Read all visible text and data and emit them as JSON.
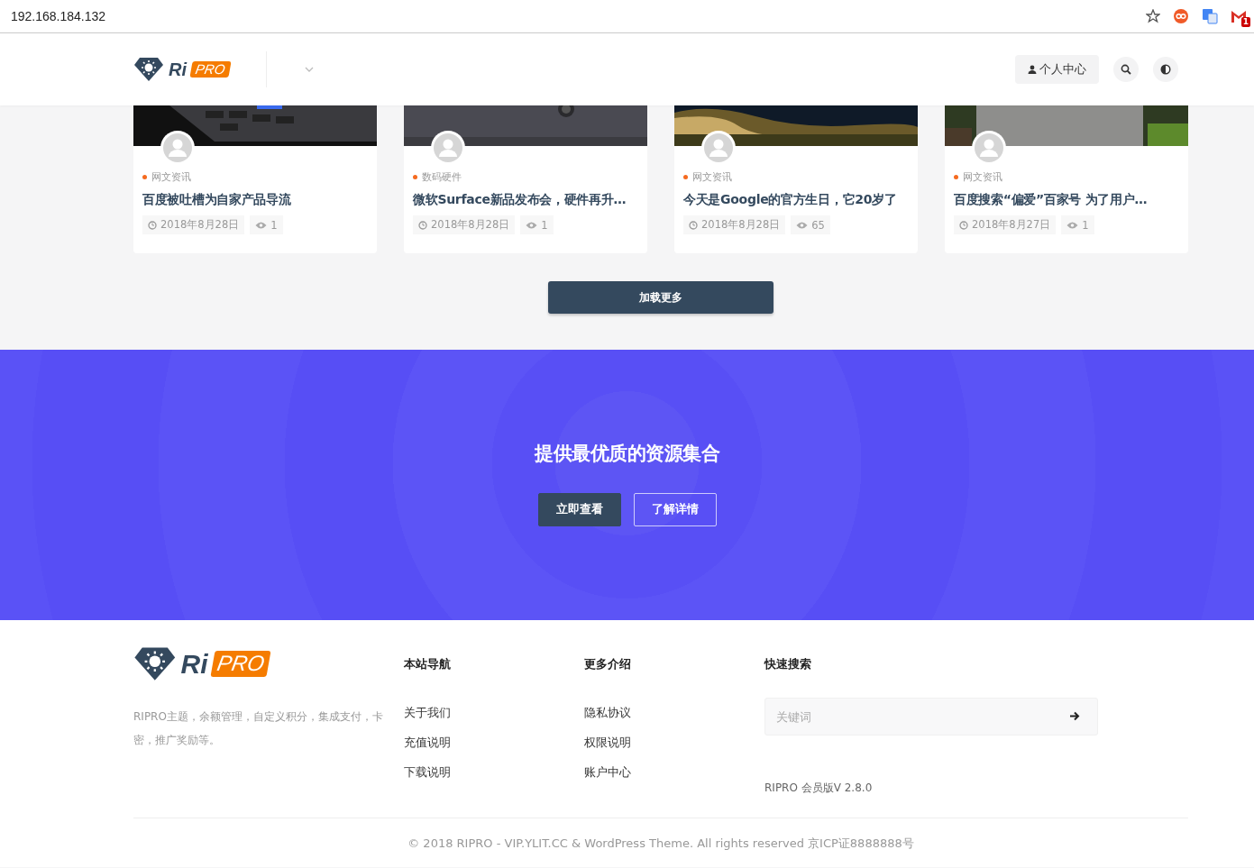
{
  "browser": {
    "url": "192.168.184.132",
    "mail_badge": "1"
  },
  "header": {
    "logo": {
      "left": "Ri",
      "right": "PRO"
    },
    "user_button": "个人中心"
  },
  "posts": [
    {
      "category": "网文资讯",
      "title": "百度被吐槽为自家产品导流",
      "date": "2018年8月28日",
      "views": "1"
    },
    {
      "category": "数码硬件",
      "title": "微软Surface新品发布会，硬件再升…",
      "date": "2018年8月28日",
      "views": "1"
    },
    {
      "category": "网文资讯",
      "title": "今天是Google的官方生日，它20岁了",
      "date": "2018年8月28日",
      "views": "65"
    },
    {
      "category": "网文资讯",
      "title": "百度搜索“偏爱”百家号 为了用户…",
      "date": "2018年8月27日",
      "views": "1"
    }
  ],
  "load_more": "加载更多",
  "banner": {
    "title": "提供最优质的资源集合",
    "buttons": [
      {
        "label": "立即查看",
        "kind": "solid"
      },
      {
        "label": "了解详情",
        "kind": "outline"
      }
    ]
  },
  "footer": {
    "logo": {
      "left": "Ri",
      "right": "PRO"
    },
    "description": "RIPRO主题，余额管理，自定义积分，集成支付，卡密，推广奖励等。",
    "columns": [
      {
        "heading": "本站导航",
        "links": [
          "关于我们",
          "充值说明",
          "下载说明"
        ]
      },
      {
        "heading": "更多介绍",
        "links": [
          "隐私协议",
          "权限说明",
          "账户中心"
        ]
      }
    ],
    "search": {
      "heading": "快速搜索",
      "placeholder": "关键词"
    },
    "version": "RIPRO 会员版V 2.8.0",
    "copyright": "© 2018 RIPRO - VIP.YLIT.CC & WordPress Theme. All rights reserved 京ICP证8888888号"
  }
}
